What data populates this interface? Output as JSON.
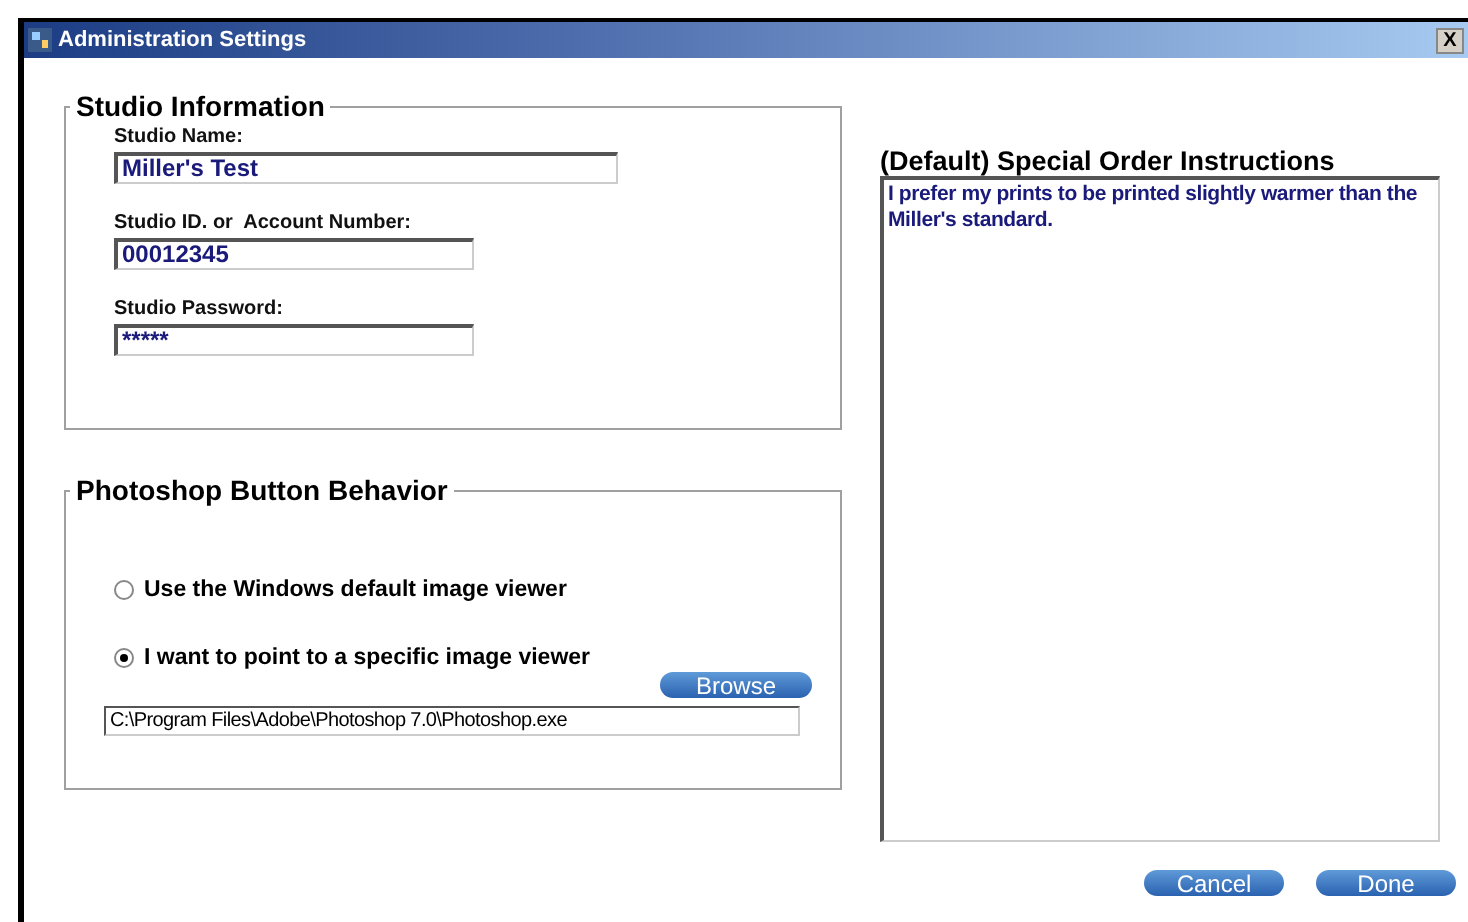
{
  "window": {
    "title": "Administration Settings",
    "close": "X"
  },
  "studio_information": {
    "title": "Studio Information",
    "fields": [
      {
        "label": "Studio Name:",
        "value": "Miller's Test"
      },
      {
        "label": "Studio ID. or  Account Number:",
        "value": "00012345"
      },
      {
        "label": "Studio Password:",
        "value": "*****"
      }
    ]
  },
  "photoshop_button_behavior": {
    "title": "Photoshop Button Behavior",
    "options": [
      {
        "label": "Use the Windows default image viewer",
        "selected": false
      },
      {
        "label": "I want to point to a specific image viewer",
        "selected": true
      }
    ],
    "browse_button": "Browse",
    "path": "C:\\Program Files\\Adobe\\Photoshop 7.0\\Photoshop.exe"
  },
  "special_order_instructions": {
    "title": "(Default) Special Order Instructions",
    "value": "I prefer my prints to be printed slightly warmer than the Miller's standard."
  },
  "buttons": [
    "Cancel",
    "Done"
  ]
}
